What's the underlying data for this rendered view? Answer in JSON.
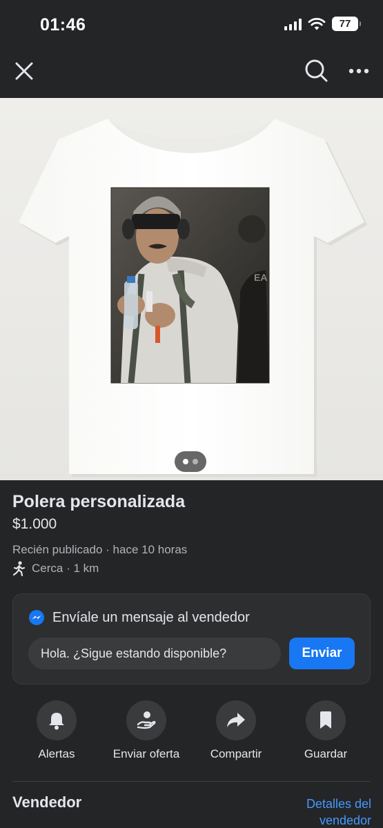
{
  "status_bar": {
    "time": "01:46",
    "battery": "77",
    "icons": [
      "signal-icon",
      "wifi-icon",
      "battery-icon"
    ]
  },
  "nav": {
    "icons": [
      "close-icon",
      "search-icon",
      "more-icon"
    ]
  },
  "product": {
    "image_indicator": {
      "current": 1,
      "total": 2
    },
    "title": "Polera personalizada",
    "price": "$1.000",
    "listed": "Recién publicado · hace 10 horas",
    "location": "Cerca · 1 km",
    "location_icon": "walking-person-icon"
  },
  "message": {
    "icon": "messenger-icon",
    "header": "Envíale un mensaje al vendedor",
    "input_value": "Hola. ¿Sigue estando disponible?",
    "send_label": "Enviar"
  },
  "actions": [
    {
      "label": "Alertas",
      "icon": "bell-icon"
    },
    {
      "label": "Enviar oferta",
      "icon": "offer-hand-icon"
    },
    {
      "label": "Compartir",
      "icon": "share-icon"
    },
    {
      "label": "Guardar",
      "icon": "bookmark-icon"
    }
  ],
  "seller": {
    "heading": "Vendedor",
    "details_link": "Detalles del vendedor"
  },
  "colors": {
    "background": "#242526",
    "accent": "#1877f2",
    "link": "#4599ff"
  }
}
